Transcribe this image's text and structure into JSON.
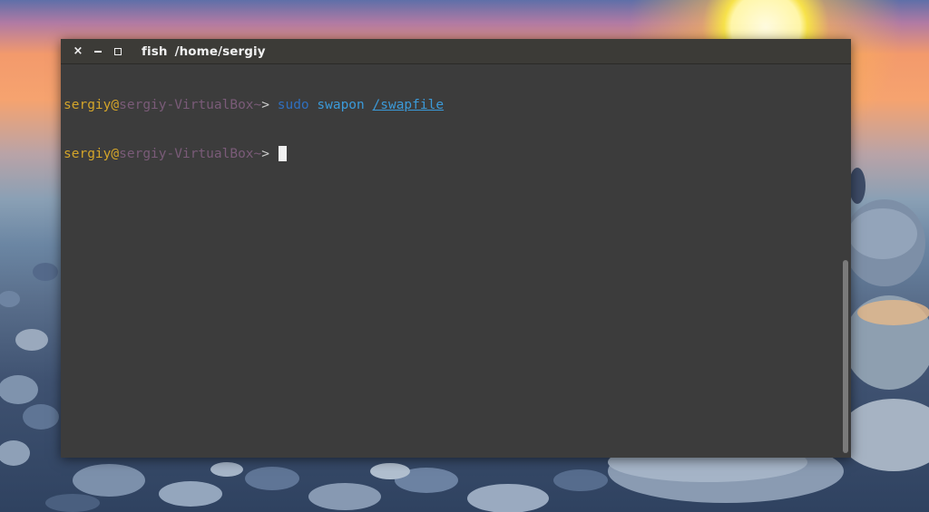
{
  "window": {
    "title_app": "fish",
    "title_path": "/home/sergiy",
    "controls": {
      "close": "×",
      "minimize": "–",
      "maximize": ""
    }
  },
  "terminal": {
    "lines": [
      {
        "user": "sergiy",
        "at": "@",
        "host": "sergiy-VirtualBox",
        "cwd": "~",
        "prompt_symbol": ">",
        "cmd_sudo": "sudo",
        "cmd_main": "swapon",
        "cmd_arg": "/swapfile"
      },
      {
        "user": "sergiy",
        "at": "@",
        "host": "sergiy-VirtualBox",
        "cwd": "~",
        "prompt_symbol": ">"
      }
    ]
  },
  "colors": {
    "terminal_bg": "#3c3c3c",
    "titlebar_bg": "#3c3b37",
    "user": "#d4a52a",
    "host": "#7a5b78",
    "command": "#3b9ad9"
  },
  "icons": [
    "close-icon",
    "minimize-icon",
    "maximize-icon"
  ]
}
